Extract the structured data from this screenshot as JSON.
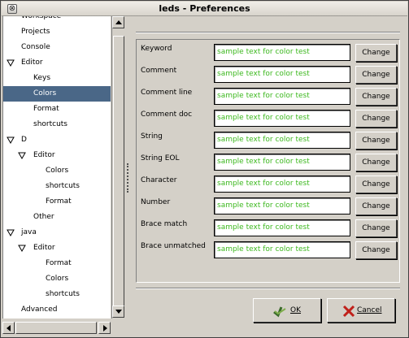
{
  "window": {
    "title": "leds - Preferences",
    "close_glyph": "⊗"
  },
  "tree": {
    "items": [
      {
        "label": "Workspace",
        "expander": "none",
        "selected": false
      },
      {
        "label": "Projects",
        "expander": "none",
        "selected": false
      },
      {
        "label": "Console",
        "expander": "none",
        "selected": false
      },
      {
        "label": "Editor",
        "expander": "expanded",
        "selected": false
      },
      {
        "label": "Keys",
        "expander": "none",
        "selected": false
      },
      {
        "label": "Colors",
        "expander": "none",
        "selected": true
      },
      {
        "label": "Format",
        "expander": "none",
        "selected": false
      },
      {
        "label": "shortcuts",
        "expander": "none",
        "selected": false
      },
      {
        "label": "D",
        "expander": "expanded",
        "selected": false
      },
      {
        "label": "Editor",
        "expander": "expanded",
        "selected": false
      },
      {
        "label": "Colors",
        "expander": "none",
        "selected": false
      },
      {
        "label": "shortcuts",
        "expander": "none",
        "selected": false
      },
      {
        "label": "Format",
        "expander": "none",
        "selected": false
      },
      {
        "label": "Other",
        "expander": "none",
        "selected": false
      },
      {
        "label": "java",
        "expander": "expanded",
        "selected": false
      },
      {
        "label": "Editor",
        "expander": "expanded",
        "selected": false
      },
      {
        "label": "Format",
        "expander": "none",
        "selected": false
      },
      {
        "label": "Colors",
        "expander": "none",
        "selected": false
      },
      {
        "label": "shortcuts",
        "expander": "none",
        "selected": false
      },
      {
        "label": "Advanced",
        "expander": "none",
        "selected": false
      }
    ]
  },
  "colors_page": {
    "sample_text_color": "#3cb81e",
    "rows": [
      {
        "label": "Keyword",
        "sample": "sample text for color test",
        "button": "Change"
      },
      {
        "label": "Comment",
        "sample": "sample text for color test",
        "button": "Change"
      },
      {
        "label": "Comment line",
        "sample": "sample text for color test",
        "button": "Change"
      },
      {
        "label": "Comment doc",
        "sample": "sample text for color test",
        "button": "Change"
      },
      {
        "label": "String",
        "sample": "sample text for color test",
        "button": "Change"
      },
      {
        "label": "String EOL",
        "sample": "sample text for color test",
        "button": "Change"
      },
      {
        "label": "Character",
        "sample": "sample text for color test",
        "button": "Change"
      },
      {
        "label": "Number",
        "sample": "sample text for color test",
        "button": "Change"
      },
      {
        "label": "Brace match",
        "sample": "sample text for color test",
        "button": "Change"
      },
      {
        "label": "Brace unmatched",
        "sample": "sample text for color test",
        "button": "Change"
      }
    ]
  },
  "buttons": {
    "ok_label": "OK",
    "cancel_label": "Cancel"
  },
  "theme": {
    "selection_color": "#4a6787",
    "window_bg": "#d4d0c8"
  },
  "icons": {
    "ok": "ok-check-icon",
    "cancel": "cancel-x-icon",
    "close": "close-icon",
    "tree_expanded": "expanded-triangle-icon"
  }
}
